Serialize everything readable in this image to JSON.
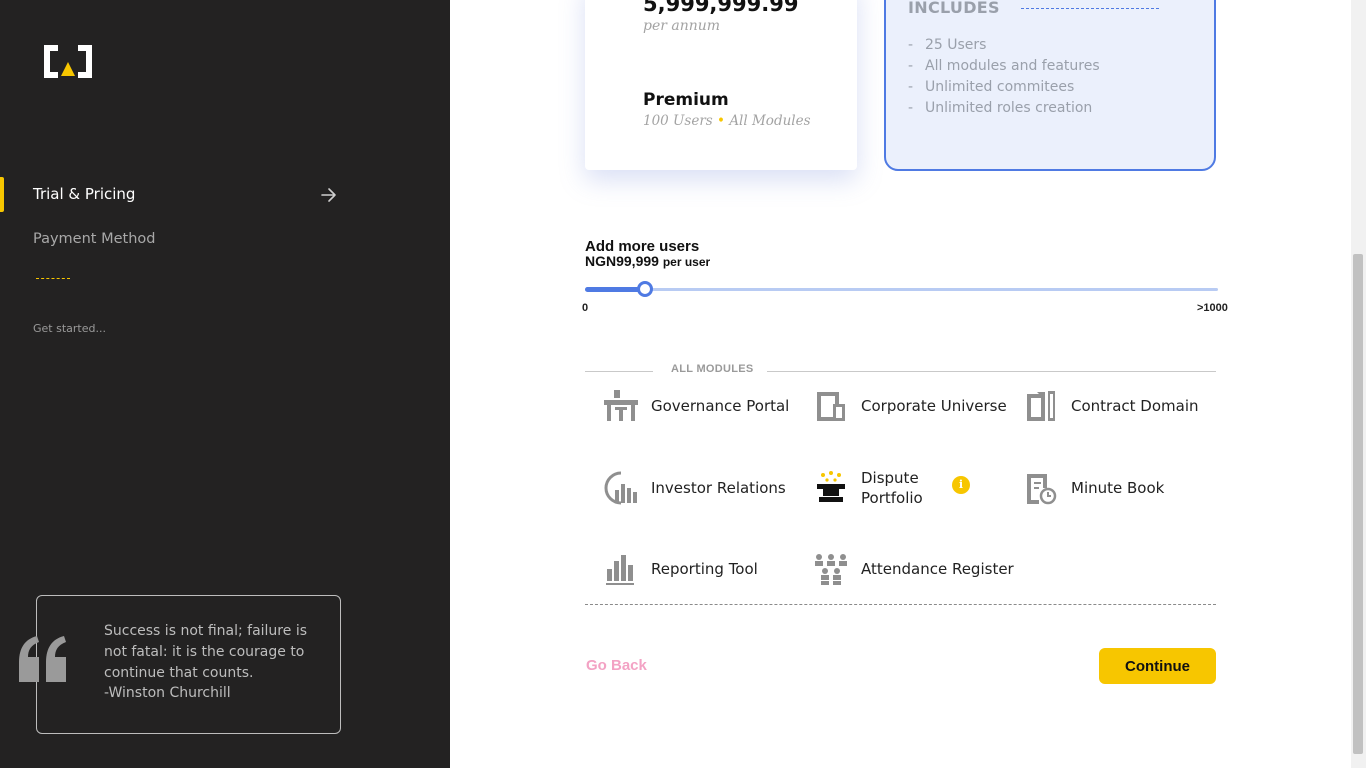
{
  "sidebar": {
    "nav": {
      "trial_pricing": "Trial & Pricing",
      "payment_method": "Payment Method",
      "get_started": "Get started..."
    },
    "quote": {
      "text": "Success is not final; failure is not fatal: it is the courage to continue that counts.",
      "author": "-Winston Churchill"
    }
  },
  "plan": {
    "price": "5,999,999.99",
    "period": "per annum",
    "name": "Premium",
    "users": "100 Users",
    "separator": "•",
    "modules": "All Modules"
  },
  "includes": {
    "title": "INCLUDES",
    "items": [
      {
        "dash": "-",
        "text": "25 Users"
      },
      {
        "dash": "-",
        "text": "All modules and features"
      },
      {
        "dash": "-",
        "text": "Unlimited commitees"
      },
      {
        "dash": "-",
        "text": "Unlimited roles creation"
      }
    ]
  },
  "add_users": {
    "title": "Add more users",
    "price": "NGN99,999",
    "per": "per user",
    "slider_min": "0",
    "slider_max": ">1000",
    "slider_value_fraction": 0.095
  },
  "modules": {
    "section_label": "ALL MODULES",
    "items": [
      {
        "label": "Governance Portal",
        "icon": "governance-icon"
      },
      {
        "label": "Corporate Universe",
        "icon": "building-icon"
      },
      {
        "label": "Contract Domain",
        "icon": "contract-icon"
      },
      {
        "label": "Investor Relations",
        "icon": "investor-chart-icon"
      },
      {
        "label": "Dispute Portfolio",
        "icon": "gavel-icon",
        "info": "i"
      },
      {
        "label": "Minute Book",
        "icon": "minute-book-icon"
      },
      {
        "label": "Reporting Tool",
        "icon": "bar-chart-icon"
      },
      {
        "label": "Attendance Register",
        "icon": "people-group-icon"
      }
    ]
  },
  "actions": {
    "go_back": "Go Back",
    "continue": "Continue"
  },
  "colors": {
    "sidebar_bg": "#232222",
    "accent_yellow": "#f7c600",
    "accent_blue": "#4f7ae3",
    "includes_bg": "#ebf0fc",
    "go_back_pink": "#f3a2c4"
  }
}
